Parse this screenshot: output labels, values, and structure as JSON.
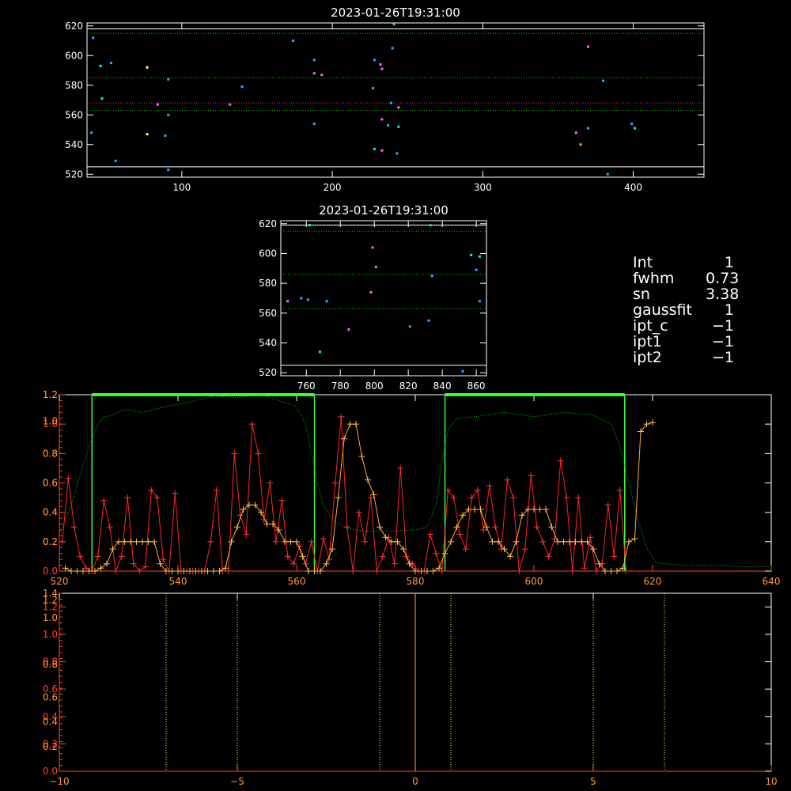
{
  "chart_data": [
    {
      "id": "panel1",
      "type": "scatter",
      "title": "2023-01-26T19:31:00",
      "xlim": [
        37,
        447
      ],
      "ylim": [
        518,
        622
      ],
      "xticks": [
        100,
        200,
        300,
        400
      ],
      "yticks": [
        520,
        540,
        560,
        580,
        600,
        620
      ],
      "hlines": [
        {
          "y": 618,
          "color": "#ffffff",
          "style": "solid"
        },
        {
          "y": 615,
          "color": "#00cc00",
          "style": "dotted"
        },
        {
          "y": 585,
          "color": "#00cc00",
          "style": "dotted"
        },
        {
          "y": 568,
          "color": "#ff3333",
          "style": "dotted"
        },
        {
          "y": 563,
          "color": "#00cc00",
          "style": "dotted"
        },
        {
          "y": 525,
          "color": "#ffffff",
          "style": "solid"
        }
      ],
      "points": [
        {
          "x": 41,
          "y": 612,
          "c": "#33aaff"
        },
        {
          "x": 46,
          "y": 593,
          "c": "#00ffcc"
        },
        {
          "x": 47,
          "y": 571,
          "c": "#00ffcc"
        },
        {
          "x": 40,
          "y": 548,
          "c": "#33aaff"
        },
        {
          "x": 53,
          "y": 595,
          "c": "#33aaff"
        },
        {
          "x": 56,
          "y": 529,
          "c": "#33aaff"
        },
        {
          "x": 77,
          "y": 592,
          "c": "#ffff66"
        },
        {
          "x": 77,
          "y": 547,
          "c": "#ffff66"
        },
        {
          "x": 84,
          "y": 567,
          "c": "#ff66ff"
        },
        {
          "x": 89,
          "y": 546,
          "c": "#33aaff"
        },
        {
          "x": 91,
          "y": 584,
          "c": "#33aaff"
        },
        {
          "x": 91,
          "y": 560,
          "c": "#33aaff"
        },
        {
          "x": 91,
          "y": 523,
          "c": "#33aaff"
        },
        {
          "x": 132,
          "y": 567,
          "c": "#ff66ff"
        },
        {
          "x": 140,
          "y": 579,
          "c": "#33aaff"
        },
        {
          "x": 174,
          "y": 610,
          "c": "#33aaff"
        },
        {
          "x": 188,
          "y": 597,
          "c": "#33aaff"
        },
        {
          "x": 188,
          "y": 588,
          "c": "#ff66ff"
        },
        {
          "x": 188,
          "y": 554,
          "c": "#33aaff"
        },
        {
          "x": 193,
          "y": 587,
          "c": "#ff66ff"
        },
        {
          "x": 228,
          "y": 597,
          "c": "#33aaff"
        },
        {
          "x": 227,
          "y": 578,
          "c": "#33aaff"
        },
        {
          "x": 228,
          "y": 537,
          "c": "#00ffcc"
        },
        {
          "x": 232,
          "y": 594,
          "c": "#ff66ff"
        },
        {
          "x": 233,
          "y": 591,
          "c": "#ff66ff"
        },
        {
          "x": 233,
          "y": 557,
          "c": "#ff66ff"
        },
        {
          "x": 233,
          "y": 536,
          "c": "#ff66ff"
        },
        {
          "x": 237,
          "y": 553,
          "c": "#33aaff"
        },
        {
          "x": 239,
          "y": 568,
          "c": "#33aaff"
        },
        {
          "x": 240,
          "y": 605,
          "c": "#33aaff"
        },
        {
          "x": 241,
          "y": 621,
          "c": "#33aaff"
        },
        {
          "x": 244,
          "y": 565,
          "c": "#ff66ff"
        },
        {
          "x": 244,
          "y": 552,
          "c": "#00ffcc"
        },
        {
          "x": 243,
          "y": 534,
          "c": "#33aaff"
        },
        {
          "x": 362,
          "y": 548,
          "c": "#ff66ff"
        },
        {
          "x": 365,
          "y": 540,
          "c": "#ff9933"
        },
        {
          "x": 370,
          "y": 606,
          "c": "#ff66ff"
        },
        {
          "x": 370,
          "y": 551,
          "c": "#33aaff"
        },
        {
          "x": 380,
          "y": 583,
          "c": "#33aaff"
        },
        {
          "x": 383,
          "y": 520,
          "c": "#33aaff"
        },
        {
          "x": 399,
          "y": 554,
          "c": "#33aaff"
        },
        {
          "x": 401,
          "y": 551,
          "c": "#00ffcc"
        }
      ]
    },
    {
      "id": "panel2",
      "type": "scatter",
      "title": "2023-01-26T19:31:00",
      "xlim": [
        745,
        866
      ],
      "ylim": [
        518,
        622
      ],
      "xticks": [
        760,
        780,
        800,
        820,
        840,
        860
      ],
      "yticks": [
        520,
        540,
        560,
        580,
        600,
        620
      ],
      "hlines": [
        {
          "y": 619,
          "color": "#ffffff",
          "style": "solid"
        },
        {
          "y": 615,
          "color": "#00cc00",
          "style": "dotted"
        },
        {
          "y": 586,
          "color": "#00cc00",
          "style": "dotted"
        },
        {
          "y": 563,
          "color": "#00cc00",
          "style": "dotted"
        },
        {
          "y": 525,
          "color": "#ffffff",
          "style": "solid"
        }
      ],
      "points": [
        {
          "x": 749,
          "y": 568,
          "c": "#ff66ff"
        },
        {
          "x": 757,
          "y": 570,
          "c": "#33aaff"
        },
        {
          "x": 761,
          "y": 569,
          "c": "#33aaff"
        },
        {
          "x": 762,
          "y": 619,
          "c": "#00ffcc"
        },
        {
          "x": 768,
          "y": 534,
          "c": "#00ffcc"
        },
        {
          "x": 772,
          "y": 568,
          "c": "#33aaff"
        },
        {
          "x": 785,
          "y": 549,
          "c": "#ff66ff"
        },
        {
          "x": 798,
          "y": 574,
          "c": "#ff66ff"
        },
        {
          "x": 799,
          "y": 604,
          "c": "#ff66ff"
        },
        {
          "x": 801,
          "y": 591,
          "c": "#ff66ff"
        },
        {
          "x": 821,
          "y": 551,
          "c": "#33aaff"
        },
        {
          "x": 832,
          "y": 555,
          "c": "#33aaff"
        },
        {
          "x": 833,
          "y": 619,
          "c": "#00ff66"
        },
        {
          "x": 834,
          "y": 585,
          "c": "#33aaff"
        },
        {
          "x": 852,
          "y": 521,
          "c": "#33aaff"
        },
        {
          "x": 857,
          "y": 599,
          "c": "#00ffcc"
        },
        {
          "x": 860,
          "y": 589,
          "c": "#33aaff"
        },
        {
          "x": 862,
          "y": 598,
          "c": "#00ffcc"
        },
        {
          "x": 862,
          "y": 568,
          "c": "#33aaff"
        }
      ]
    },
    {
      "id": "panel3",
      "type": "line",
      "title": "",
      "xlim": [
        520,
        640
      ],
      "ylim": [
        0,
        1.2
      ],
      "xticks": [
        520,
        540,
        560,
        580,
        600,
        620,
        640
      ],
      "yticks_left": [
        "1.2",
        "1.0",
        "0.8",
        "0.6",
        "0.4",
        "0.2",
        "0.0"
      ],
      "yticks_left_values": [
        1.2,
        1.0,
        0.8,
        0.6,
        0.4,
        0.2,
        0.0
      ],
      "yticks_left_alt": [
        "1.2",
        "1.0",
        "0.8",
        "0.6",
        "0.4",
        "0.2"
      ],
      "yticks_left_alt_values": [
        1.2,
        1.02,
        0.8,
        0.6,
        0.4,
        0.2
      ],
      "green_windows": [
        [
          525.5,
          563
        ],
        [
          585,
          615.3
        ]
      ],
      "green_window_top": 1.2,
      "series": [
        {
          "line": "#00cc00",
          "style": "dotted",
          "x": [
            520,
            522,
            524,
            525.5,
            526.5,
            527.5,
            529,
            531,
            534,
            538,
            542,
            546,
            550,
            554,
            557,
            560,
            561.5,
            562.5,
            563.5,
            564.5,
            566,
            568,
            570,
            572,
            575,
            580,
            582,
            583.5,
            584.5,
            585.5,
            587,
            590,
            595,
            600,
            605,
            610,
            613,
            614.5,
            616,
            617.5,
            619,
            620.5,
            622,
            625,
            630,
            635,
            640
          ],
          "y": [
            0.25,
            0.45,
            0.72,
            0.9,
            1.0,
            1.05,
            1.06,
            1.1,
            1.08,
            1.12,
            1.15,
            1.19,
            1.18,
            1.2,
            1.16,
            1.12,
            1.0,
            0.8,
            0.6,
            0.45,
            0.35,
            0.3,
            0.28,
            0.27,
            0.27,
            0.28,
            0.3,
            0.45,
            0.75,
            0.96,
            1.04,
            1.05,
            1.08,
            1.05,
            1.08,
            1.06,
            1.0,
            0.85,
            0.6,
            0.35,
            0.16,
            0.06,
            0.05,
            0.04,
            0.04,
            0.03,
            0.03
          ]
        },
        {
          "line": "#ff2222",
          "marker": "+",
          "markerColor": "#ff3333",
          "x": [
            520.5,
            521.5,
            522.5,
            523.5,
            524.5,
            525.5,
            526.5,
            527.5,
            528.5,
            529.5,
            530.5,
            531.5,
            532.5,
            533.5,
            534.5,
            535.5,
            536.5,
            537.5,
            538.5,
            539.5,
            540.5,
            541.5,
            542.5,
            543.5,
            544.5,
            545.5,
            546.5,
            547.5,
            548.5,
            549.5,
            550.5,
            551.5,
            552.5,
            553.5,
            554.5,
            555.5,
            556.5,
            557.5,
            558.5,
            559.5,
            560.5,
            561.5,
            562.5,
            563.5,
            564.5,
            565.5,
            566.5,
            567.5,
            568.5,
            569.5,
            570.5,
            571.5,
            572.5,
            573.5,
            574.5,
            575.5,
            576.5,
            577.5,
            578.5,
            579.5,
            580.5,
            581.5,
            582.5,
            583.5,
            584.5,
            585.5,
            586.5,
            587.5,
            588.5,
            589.5,
            590.5,
            591.5,
            592.5,
            593.5,
            594.5,
            595.5,
            596.5,
            597.5,
            598.5,
            599.5,
            600.5,
            601.5,
            602.5,
            603.5,
            604.5,
            605.5,
            606.5,
            607.5,
            608.5,
            609.5,
            610.5,
            611.5,
            612.5,
            613.5,
            614.5,
            615.5
          ],
          "y": [
            0.2,
            0.63,
            0.3,
            0.1,
            0.02,
            0.0,
            0.1,
            0.48,
            0.3,
            0.0,
            0.1,
            0.5,
            0.05,
            0.0,
            0.03,
            0.55,
            0.5,
            0.08,
            0.0,
            0.53,
            0.0,
            0.0,
            0.0,
            0.0,
            0.0,
            0.2,
            0.55,
            0.0,
            0.0,
            0.8,
            0.38,
            0.25,
            1.0,
            0.8,
            0.35,
            0.6,
            0.2,
            0.48,
            0.1,
            0.05,
            0.17,
            0.05,
            0.2,
            0.0,
            0.22,
            0.08,
            0.6,
            1.05,
            0.3,
            0.0,
            0.4,
            0.2,
            0.5,
            0.0,
            0.1,
            0.23,
            0.05,
            0.7,
            0.1,
            0.05,
            0.0,
            0.0,
            0.25,
            0.12,
            0.0,
            0.55,
            0.5,
            0.25,
            0.15,
            0.5,
            0.55,
            0.28,
            0.58,
            0.3,
            0.15,
            0.62,
            0.5,
            0.0,
            0.15,
            0.65,
            0.3,
            0.2,
            0.1,
            0.22,
            0.75,
            0.5,
            0.0,
            0.5,
            0.02,
            0.23,
            0.0,
            0.05,
            0.45,
            0.1,
            0.55,
            0.0
          ]
        },
        {
          "line": "#ffaa33",
          "marker": "+",
          "markerColor": "#ffbb44",
          "x": [
            521,
            522,
            523,
            524,
            525,
            526,
            527,
            528,
            529,
            530,
            531,
            532,
            533,
            534,
            535,
            536,
            537,
            538,
            539,
            540,
            541,
            542,
            543,
            544,
            545,
            546,
            547,
            548,
            549,
            550,
            551,
            552,
            553,
            554,
            555,
            556,
            557,
            558,
            559,
            560,
            561,
            562,
            563,
            564,
            565,
            566,
            567,
            568,
            569,
            570,
            571,
            572,
            573,
            574,
            575,
            576,
            577,
            578,
            579,
            580,
            581,
            582,
            583,
            584,
            585,
            586,
            587,
            588,
            589,
            590,
            591,
            592,
            593,
            594,
            595,
            596,
            597,
            598,
            599,
            600,
            601,
            602,
            603,
            604,
            605,
            606,
            607,
            608,
            609,
            610,
            611,
            612,
            613,
            614,
            615,
            616,
            617,
            618,
            619,
            620
          ],
          "y": [
            0.02,
            0.0,
            0.0,
            0.0,
            0.0,
            0.0,
            0.02,
            0.05,
            0.15,
            0.2,
            0.2,
            0.2,
            0.2,
            0.2,
            0.2,
            0.2,
            0.05,
            0.0,
            0.0,
            0.0,
            0.0,
            0.0,
            0.0,
            0.0,
            0.0,
            0.0,
            0.0,
            0.02,
            0.2,
            0.3,
            0.42,
            0.45,
            0.45,
            0.4,
            0.32,
            0.32,
            0.28,
            0.2,
            0.2,
            0.2,
            0.1,
            0.0,
            0.0,
            0.0,
            0.05,
            0.15,
            0.5,
            0.9,
            1.0,
            1.0,
            0.78,
            0.62,
            0.52,
            0.3,
            0.23,
            0.2,
            0.2,
            0.15,
            0.05,
            0.0,
            0.0,
            0.0,
            0.0,
            0.02,
            0.12,
            0.2,
            0.3,
            0.38,
            0.42,
            0.42,
            0.42,
            0.3,
            0.2,
            0.2,
            0.15,
            0.1,
            0.2,
            0.38,
            0.42,
            0.42,
            0.42,
            0.42,
            0.3,
            0.2,
            0.2,
            0.2,
            0.2,
            0.2,
            0.2,
            0.15,
            0.05,
            0.0,
            0.0,
            0.0,
            0.02,
            0.2,
            0.22,
            0.95,
            1.0,
            1.01
          ]
        }
      ]
    },
    {
      "id": "panel4",
      "type": "line",
      "title": "",
      "xlim": [
        -10,
        10
      ],
      "ylim": [
        0,
        1.3
      ],
      "xticks": [
        -10,
        -5,
        0,
        5,
        10
      ],
      "yticks_left": [
        "1.2",
        "1.0",
        "0.8",
        "0.6",
        "0.4",
        "0.2",
        "0.0"
      ],
      "yticks_left_values": [
        1.2,
        1.0,
        0.8,
        0.6,
        0.4,
        0.2,
        0.0
      ],
      "yticks_left_alt": [
        "1.4",
        "1.2",
        "1.0",
        "0.8",
        "0.6",
        "0.4",
        "0.2"
      ],
      "yticks_left_alt_values": [
        1.3,
        1.25,
        1.12,
        0.78,
        0.54,
        0.36,
        0.18
      ],
      "vlines": [
        {
          "x": -7,
          "color": "#ffff66",
          "style": "dotted"
        },
        {
          "x": -5,
          "color": "#ffff66",
          "style": "dotted"
        },
        {
          "x": -1,
          "color": "#ffff66",
          "style": "dotted"
        },
        {
          "x": 0,
          "color": "#ffaa33",
          "style": "solid"
        },
        {
          "x": 1,
          "color": "#ffff66",
          "style": "dotted"
        },
        {
          "x": 5,
          "color": "#ffff66",
          "style": "dotted"
        },
        {
          "x": 7,
          "color": "#ffff66",
          "style": "dotted"
        }
      ]
    }
  ],
  "info_panel": [
    {
      "key": "Int",
      "value": "1"
    },
    {
      "key": "fwhm",
      "value": "0.73"
    },
    {
      "key": "sn",
      "value": "3.38"
    },
    {
      "key": "gaussfit",
      "value": "1"
    },
    {
      "key": "ipt_c",
      "value": "−1"
    },
    {
      "key": "ipt1",
      "value": "−1"
    },
    {
      "key": "ipt2",
      "value": "−1"
    }
  ]
}
